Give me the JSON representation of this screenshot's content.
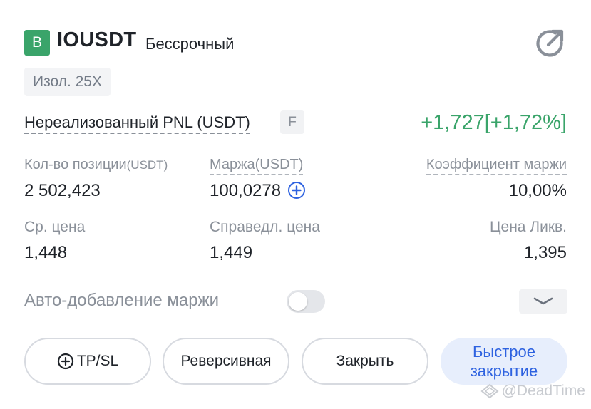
{
  "position": {
    "side_badge": "B",
    "symbol": "IOUSDT",
    "contract_type": "Бессрочный",
    "margin_mode": "Изол. 25X"
  },
  "pnl": {
    "label": "Нереализованный PNL (USDT)",
    "badge": "F",
    "value": "+1,727[+1,72%]",
    "color": "#3aa46a"
  },
  "stats": {
    "size_label": "Кол-во позиции",
    "size_unit": "(USDT)",
    "size_value": "2 502,423",
    "margin_label": "Маржа(USDT)",
    "margin_value": "100,0278",
    "margin_ratio_label": "Коэффициент маржи",
    "margin_ratio_value": "10,00%",
    "entry_label": "Ср. цена",
    "entry_value": "1,448",
    "mark_label": "Справедл. цена",
    "mark_value": "1,449",
    "liq_label": "Цена Ликв.",
    "liq_value": "1,395"
  },
  "auto_margin": {
    "label": "Авто-добавление маржи",
    "enabled": false
  },
  "actions": {
    "tpsl": "TP/SL",
    "reverse": "Реверсивная",
    "close": "Закрыть",
    "quick_close_line1": "Быстрое",
    "quick_close_line2": "закрытие"
  },
  "icons": {
    "share": "share-arrow-icon",
    "add_margin": "plus-circle-icon",
    "expand": "chevron-down-icon",
    "tpsl": "plus-circle-icon"
  },
  "watermark": "@DeadTime",
  "colors": {
    "accent_blue": "#2e62e0",
    "buy_green": "#3aa46a"
  }
}
